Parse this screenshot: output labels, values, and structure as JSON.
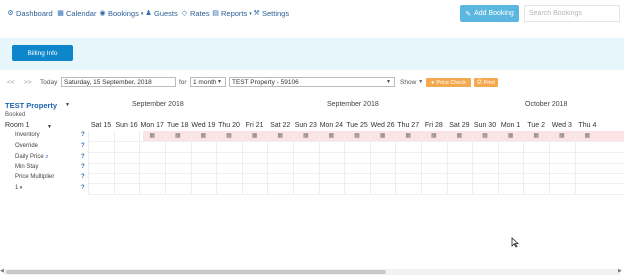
{
  "nav": {
    "items": [
      {
        "label": "Dashboard",
        "icon": "dashboard-icon"
      },
      {
        "label": "Calendar",
        "icon": "calendar-icon"
      },
      {
        "label": "Bookings",
        "icon": "bookings-icon",
        "dropdown": true
      },
      {
        "label": "Guests",
        "icon": "guests-icon"
      },
      {
        "label": "Rates",
        "icon": "rates-icon"
      },
      {
        "label": "Reports",
        "icon": "reports-icon",
        "dropdown": true
      },
      {
        "label": "Settings",
        "icon": "settings-icon"
      }
    ],
    "add_booking": "Add Booking",
    "search_placeholder": "Search Bookings"
  },
  "billing_button": "Billing Info",
  "controls": {
    "prev": "<<",
    "next": ">>",
    "today": "Today",
    "date": "Saturday, 15 September, 2018",
    "for_label": "for",
    "period": "1 month",
    "property": "TEST Property - 59106",
    "show_label": "Show",
    "price_check": "Price Check",
    "print": "Print"
  },
  "calendar": {
    "property_title": "TEST Property",
    "booked_label": "Booked",
    "room_label": "Room 1",
    "months": [
      "September 2018",
      "September 2018",
      "October 2018"
    ],
    "days": [
      "Sat 15",
      "Sun 16",
      "Mon 17",
      "Tue 18",
      "Wed 19",
      "Thu 20",
      "Fri 21",
      "Sat 22",
      "Sun 23",
      "Mon 24",
      "Tue 25",
      "Wed 26",
      "Thu 27",
      "Fri 28",
      "Sat 29",
      "Sun 30",
      "Mon 1",
      "Tue 2",
      "Wed 3",
      "Thu 4"
    ],
    "rows": [
      "Inventory",
      "Override",
      "Daily Price",
      "Min Stay",
      "Price Multiplier",
      "1"
    ],
    "help_mark": "?"
  },
  "colors": {
    "accent": "#0d86cc",
    "add_button": "#5bb7e0",
    "band": "#e7f6fb",
    "inventory_row": "#fbe3e6",
    "print_buttons": "#f4a94f",
    "property_title": "#1e63ae"
  }
}
